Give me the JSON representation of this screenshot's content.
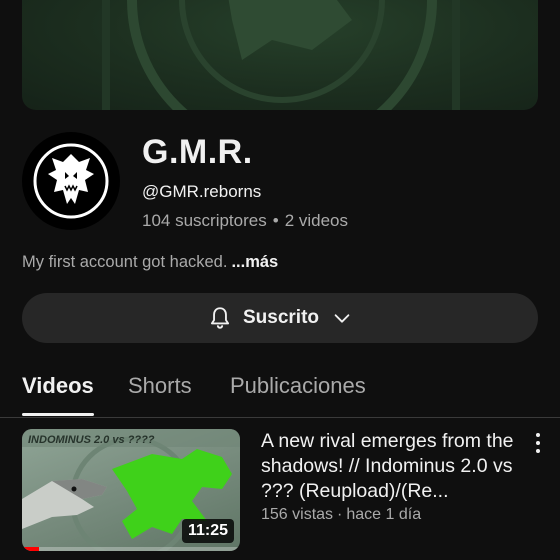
{
  "channel": {
    "name": "G.M.R.",
    "handle": "@GMR.reborns",
    "subscribers": "104 suscriptores",
    "separator": "•",
    "video_count": "2 videos",
    "description": "My first account got hacked.",
    "more_label": "...más",
    "avatar_icon": "dinosaur-skull-icon"
  },
  "subscribe_button": {
    "label": "Suscrito",
    "icon": "bell-icon",
    "dropdown_icon": "chevron-down-icon"
  },
  "tabs": [
    {
      "label": "Videos",
      "active": true
    },
    {
      "label": "Shorts",
      "active": false
    },
    {
      "label": "Publicaciones",
      "active": false
    }
  ],
  "videos": [
    {
      "title": "A new rival emerges from the shadows! // Indominus 2.0 vs ??? (Reupload)/(Re...",
      "views": "156 vistas",
      "separator": "·",
      "age": "hace 1 día",
      "duration": "11:25",
      "watched_fraction": 0.08,
      "thumbnail_text": "INDOMINUS 2.0 vs ????"
    }
  ],
  "colors": {
    "background": "#0f0f0f",
    "button": "#272727",
    "secondary_text": "#aaaaaa",
    "primary_text": "#f1f1f1",
    "progress": "#ff0000",
    "banner": "#1c2e1f",
    "thumbnail_silhouette": "#3fd11a"
  }
}
